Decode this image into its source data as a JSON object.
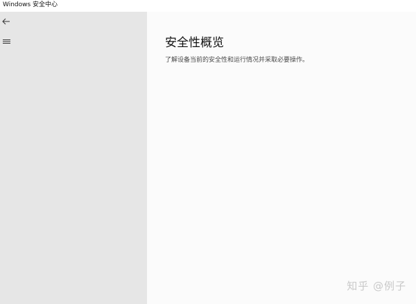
{
  "window": {
    "title": "Windows 安全中心"
  },
  "sidebar": {
    "back_icon": "arrow-left-icon",
    "menu_icon": "hamburger-menu-icon"
  },
  "main": {
    "title": "安全性概览",
    "subtitle": "了解设备当前的安全性和运行情况并采取必要操作。"
  },
  "watermark": {
    "text": "知乎 @例子"
  },
  "colors": {
    "sidebar_bg": "#e6e6e6",
    "main_bg": "#fbfbfb",
    "titlebar_bg": "#ffffff",
    "text": "#111111",
    "subtitle_text": "#4a4a4a",
    "watermark_text": "#c9c9c9"
  }
}
